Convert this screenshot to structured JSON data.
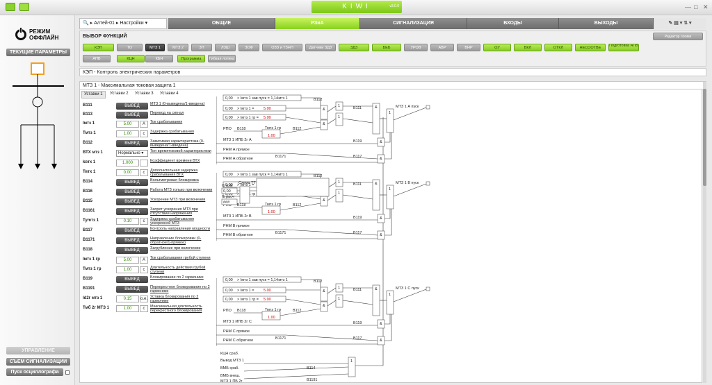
{
  "app": {
    "logo": "KIWI",
    "version": "v3.0.0"
  },
  "sidebar": {
    "mode_line1": "РЕЖИМ",
    "mode_line2": "ОФФЛАЙН",
    "current_params": "ТЕКУЩИЕ ПАРАМЕТРЫ",
    "control": "УПРАВЛЕНИЕ",
    "reset_signals": "СЪЕМ СИГНАЛИЗАЦИИ",
    "osc_start": "Пуск осциллографа"
  },
  "toolbar": {
    "device": "Алтей-01",
    "settings": "Настройки",
    "tabs": [
      "ОБЩИЕ",
      "РЗиА",
      "СИГНАЛИЗАЦИЯ",
      "ВХОДЫ",
      "ВЫХОДЫ"
    ],
    "active_tab": 1
  },
  "functions": {
    "title": "ВЫБОР ФУНКЦИЙ",
    "logic_editor": "Редактор логики",
    "row1": [
      "КЭП",
      "ТО",
      "МТЗ 1",
      "МТЗ 2",
      "ЗП",
      "ЛЗШ",
      "ЗОФ",
      "ОЗЗ и ТЗНП",
      "Датчики ЗДЗ",
      "ЗДЗ",
      "БЕБ",
      "УРОВ",
      "АВР",
      "ВНР",
      "ОУ",
      "ВКЛ",
      "ОТКЛ",
      "НЕСООТВЕ",
      "Подготовка АПВ"
    ],
    "row2": [
      "АПВ",
      "КЦН",
      "КБН",
      "Программа",
      "Гибкая логика"
    ]
  },
  "section_kep": "КЭП - Контроль электрических параметров",
  "section_mtz": "МТЗ 1 - Максимальная токовая защита 1",
  "setting_tabs": [
    "Уставки 1",
    "Уставки 2",
    "Уставки 3",
    "Уставки 4"
  ],
  "params": [
    {
      "label": "В111",
      "type": "btn",
      "value": "ВЫВЕД",
      "desc": "МТЗ 1 (0-выведена/1-введена)"
    },
    {
      "label": "В113",
      "type": "btn",
      "value": "ВЫВЕД",
      "desc": "Перевод на сигнал"
    },
    {
      "label": "Iмтз 1",
      "type": "num",
      "value": "5.00",
      "unit": "А",
      "desc": "Ток срабатывания"
    },
    {
      "label": "Тмтз 1",
      "type": "num",
      "value": "1.00",
      "unit": "с",
      "desc": "Задержка срабатывания"
    },
    {
      "label": "В112",
      "type": "btn",
      "value": "ВЫВЕД",
      "desc": "Зависимая характеристика (0-выведена/1-введена)"
    },
    {
      "label": "ВТХ мтз 1",
      "type": "sel",
      "value": "Нормально",
      "desc": "Тип времятоковой характеристики"
    },
    {
      "label": "kвтх 1",
      "type": "num",
      "value": "1.000",
      "unit": "",
      "desc": "Коэффициент времени ВТХ"
    },
    {
      "label": "Твтх 1",
      "type": "num",
      "value": "0.00",
      "unit": "с",
      "desc": "Дополнительная задержка срабатывания ВТХ"
    },
    {
      "label": "В114",
      "type": "btn",
      "value": "ВЫВЕД",
      "desc": "Вольтметровая блокировка"
    },
    {
      "label": "В116",
      "type": "btn",
      "value": "ВЫВЕД",
      "desc": "Работа МТЗ только при включении"
    },
    {
      "label": "В115",
      "type": "btn",
      "value": "ВЫВЕД",
      "desc": "Ускорение МТЗ при включении"
    },
    {
      "label": "В1161",
      "type": "btn",
      "value": "ВЫВЕД",
      "desc": "Запрет ускорения МТЗ при отсутствии напряжения"
    },
    {
      "label": "Туmтз 1",
      "type": "num",
      "value": "0.10",
      "unit": "с",
      "desc": "Задержка срабатывания ускоренной МТЗ"
    },
    {
      "label": "В117",
      "type": "btn",
      "value": "ВЫВЕД",
      "desc": "Контроль направления мощности"
    },
    {
      "label": "В1171",
      "type": "btn",
      "value": "ВЫВЕД",
      "desc": "Направление блокировки (0-обратное/1-прямое)"
    },
    {
      "label": "В118",
      "type": "btn",
      "value": "ВЫВЕД",
      "desc": "Загрубление при включении"
    },
    {
      "label": "Iмтз 1 гр",
      "type": "num",
      "value": "5.00",
      "unit": "А",
      "desc": "Ток срабатывания грубой ступени"
    },
    {
      "label": "Тмтз 1 гр",
      "type": "num",
      "value": "1.00",
      "unit": "с",
      "desc": "Длительность действия грубой ступени"
    },
    {
      "label": "В119",
      "type": "btn",
      "value": "ВЫВЕД",
      "desc": "Блокирование по 2 гармонике"
    },
    {
      "label": "В1191",
      "type": "btn",
      "value": "ВЫВЕД",
      "desc": "Перекрестное блокирование по 2 гармонике"
    },
    {
      "label": "Id2г мтз 1",
      "type": "num",
      "value": "0.15",
      "unit": "о.е.",
      "desc": "Уставка блокирования по 2 гармонике"
    },
    {
      "label": "Тмб 2г МТЗ 1",
      "type": "num",
      "value": "1.00",
      "unit": "с",
      "desc": "Максимальная длительность перекрестного блокирования"
    }
  ],
  "diagram": {
    "input_zero": "0,00",
    "cmp1": "> Iмтз 1 зав пуск = 1,1•Iмтз 1",
    "cmp2": "> Iмтз 1 =",
    "cmp2v": "5.00",
    "cmp3": "> Iмтз 1 гр =",
    "cmp3v": "5.00",
    "rpo": "РПО",
    "b118": "В118",
    "tmtz_gr": "Тмтз 1 гр",
    "tval": "1.00",
    "b112": "В112",
    "b111": "В111",
    "b119": "В119",
    "b117": "В117",
    "b1171": "В1171",
    "ipb_a": "МТЗ 1 ИПБ 2г А",
    "ipb_b": "МТЗ 1 ИПБ 2г В",
    "ipb_c": "МТЗ 1 ИПБ 2г С",
    "rnm_a1": "РНМ А прямое",
    "rnm_a2": "РНМ А обратное",
    "rnm_b1": "РНМ В прямое",
    "rnm_b2": "РНМ В обратное",
    "rnm_c1": "РНМ С прямое",
    "rnm_c2": "РНМ С обратное",
    "out_a": "МТЗ 1 А пуск",
    "out_b": "МТЗ 1 В пуск",
    "out_c": "МТЗ 1 С пуск",
    "ib_izm": "Ib изм",
    "ib_rasch": "Ib расч",
    "scheme": "Схема ТТ",
    "hash": "###",
    "and": "&",
    "or": "1",
    "kcn": "КЦН сраб.",
    "vyvod": "Вывод МТЗ 1",
    "bmb1": "ВМБ сраб.",
    "bmb2": "ВМБ внеш.",
    "pv2g": "МТЗ 1 ПБ 2г",
    "b114": "В114",
    "b1191": "В1191"
  }
}
